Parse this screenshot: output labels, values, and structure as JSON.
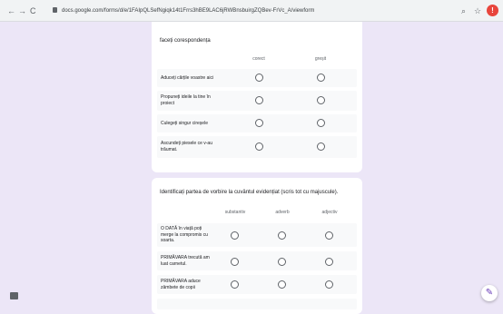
{
  "browser": {
    "back": "←",
    "forward": "→",
    "reload": "C",
    "url": "docs.google.com/forms/d/e/1FAIpQLSefNgiqk14t1Frrs3hBE9LAC6jRWBnsbuirgZQBev-FrVc_A/viewform",
    "zoom_icon": "search-icon",
    "star": "☆",
    "profile_initial": "!"
  },
  "q1": {
    "title": "faceți corespondența",
    "columns": [
      "corect",
      "greșit"
    ],
    "rows": [
      "Aduceți cărțile voastre aici",
      "Propuneți ideile la tine în proiect",
      "Culegeți singur cireșele",
      "Ascundeți piesele ce v-au trăumat."
    ]
  },
  "q2": {
    "title": "Identificați partea de vorbire la cuvântul evidențiat (scris tot cu majuscule).",
    "columns": [
      "substantiv",
      "adverb",
      "adjectiv"
    ],
    "rows": [
      "O DATĂ în viață poți merge la compromis cu soarta.",
      "PRIMĂVARA trecută am luat carnetul.",
      "PRIMĂVARA aduce zâmbete de copii"
    ]
  },
  "fab": {
    "edit": "✎"
  }
}
